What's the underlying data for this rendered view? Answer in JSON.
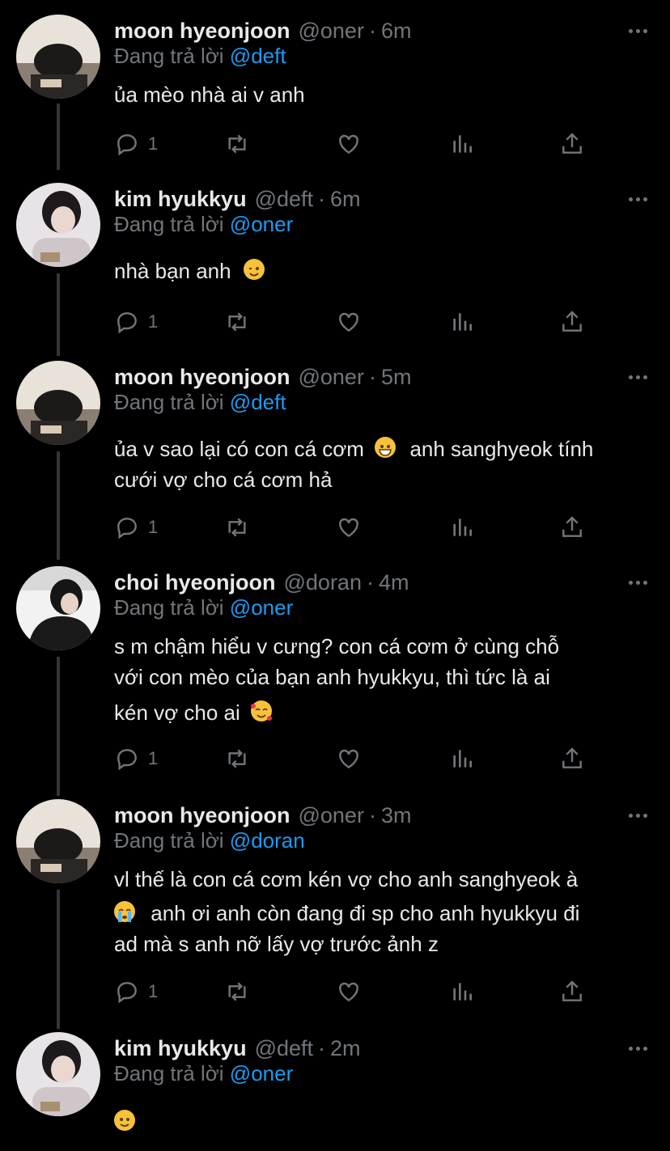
{
  "replying_prefix": "Đang trả lời",
  "tweets": [
    {
      "name": "moon hyeonjoon",
      "handle": "@oner",
      "time": "6m",
      "reply_to": "@deft",
      "lines": [
        "ủa mèo nhà ai v anh"
      ],
      "reply_count": "1"
    },
    {
      "name": "kim hyukkyu",
      "handle": "@deft",
      "time": "6m",
      "reply_to": "@oner",
      "lines": [
        "nhà bạn anh"
      ],
      "emoji": "winking-face",
      "reply_count": "1"
    },
    {
      "name": "moon hyeonjoon",
      "handle": "@oner",
      "time": "5m",
      "reply_to": "@deft",
      "lines": [
        "ủa v sao lại có con cá cơm",
        "anh sanghyeok tính",
        "cưới vợ cho cá cơm hả"
      ],
      "emoji": "grinning-face",
      "reply_count": "1"
    },
    {
      "name": "choi hyeonjoon",
      "handle": "@doran",
      "time": "4m",
      "reply_to": "@oner",
      "lines": [
        "s m chậm hiểu v cưng? con cá cơm ở cùng chỗ",
        "với con mèo của bạn anh hyukkyu, thì tức là ai",
        "kén vợ cho ai"
      ],
      "emoji": "smiling-face-with-hearts",
      "reply_count": "1"
    },
    {
      "name": "moon hyeonjoon",
      "handle": "@oner",
      "time": "3m",
      "reply_to": "@doran",
      "lines": [
        "vl thế là con cá cơm kén vợ cho anh sanghyeok à",
        "anh ơi anh còn đang đi sp cho anh hyukkyu đi",
        "ad mà s anh nỡ lấy vợ trước ảnh z"
      ],
      "emoji": "loudly-crying-face",
      "reply_count": "1"
    },
    {
      "name": "kim hyukkyu",
      "handle": "@deft",
      "time": "2m",
      "reply_to": "@oner",
      "lines": [
        ""
      ],
      "emoji": "slightly-smiling-face",
      "reply_count": ""
    }
  ],
  "colors": {
    "background": "#000000",
    "text": "#e7e9ea",
    "muted": "#71767b",
    "mention": "#1d9bf0",
    "emoji": "#f7c23a"
  },
  "icons": [
    "reply-icon",
    "retweet-icon",
    "like-icon",
    "analytics-icon",
    "share-icon",
    "more-icon"
  ]
}
